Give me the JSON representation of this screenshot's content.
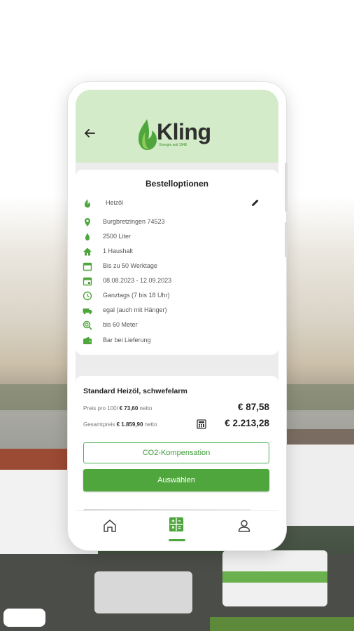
{
  "brand": {
    "name": "Kling",
    "tagline": "Energie seit 1948",
    "accent_color": "#4fa63c",
    "header_color": "#d3ebc8"
  },
  "options": {
    "title": "Bestelloptionen",
    "items": [
      {
        "icon": "flame-icon",
        "text": "Heizöl"
      },
      {
        "icon": "location-pin-icon",
        "text": "Burgbretzingen 74523"
      },
      {
        "icon": "drop-icon",
        "text": "2500 Liter"
      },
      {
        "icon": "house-icon",
        "text": "1 Haushalt"
      },
      {
        "icon": "calendar-icon",
        "text": "Bis zu 50 Werktage"
      },
      {
        "icon": "calendar-event-icon",
        "text": "08.08.2023 - 12.09.2023"
      },
      {
        "icon": "clock-icon",
        "text": "Ganztags (7 bis 18 Uhr)"
      },
      {
        "icon": "truck-icon",
        "text": "egal (auch mit Hänger)"
      },
      {
        "icon": "hose-icon",
        "text": "bis 60 Meter"
      },
      {
        "icon": "wallet-icon",
        "text": "Bar bei Lieferung"
      }
    ]
  },
  "product": {
    "title": "Standard Heizöl, schwefelarm",
    "unit_price_label": "Preis pro 100l",
    "unit_price_net": "€ 73,60",
    "unit_price_suffix": "netto",
    "unit_price_gross": "€ 87,58",
    "total_label": "Gesamtpreis",
    "total_net": "€ 1.859,90",
    "total_suffix": "netto",
    "total_gross": "€ 2.213,28",
    "co2_button": "CO2-Kompensation",
    "select_button": "Auswählen"
  },
  "nav": {
    "items": [
      "home-icon",
      "calculator-icon",
      "user-icon"
    ],
    "active": "calculator-icon"
  }
}
